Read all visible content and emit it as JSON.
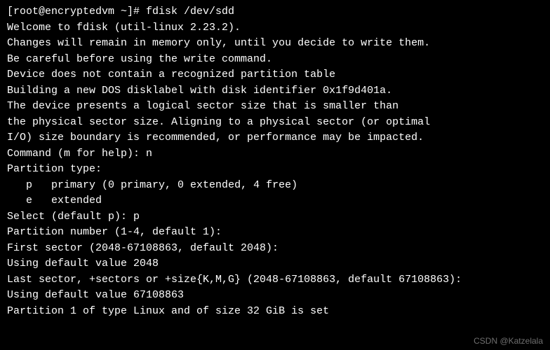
{
  "terminal": {
    "lines": [
      "[root@encryptedvm ~]# fdisk /dev/sdd",
      "Welcome to fdisk (util-linux 2.23.2).",
      "",
      "Changes will remain in memory only, until you decide to write them.",
      "Be careful before using the write command.",
      "",
      "Device does not contain a recognized partition table",
      "Building a new DOS disklabel with disk identifier 0x1f9d401a.",
      "",
      "The device presents a logical sector size that is smaller than",
      "the physical sector size. Aligning to a physical sector (or optimal",
      "I/O) size boundary is recommended, or performance may be impacted.",
      "",
      "Command (m for help): n",
      "Partition type:",
      "   p   primary (0 primary, 0 extended, 4 free)",
      "   e   extended",
      "Select (default p): p",
      "Partition number (1-4, default 1):",
      "First sector (2048-67108863, default 2048):",
      "Using default value 2048",
      "Last sector, +sectors or +size{K,M,G} (2048-67108863, default 67108863):",
      "Using default value 67108863",
      "Partition 1 of type Linux and of size 32 GiB is set"
    ]
  },
  "watermark": "CSDN @Katzelala"
}
